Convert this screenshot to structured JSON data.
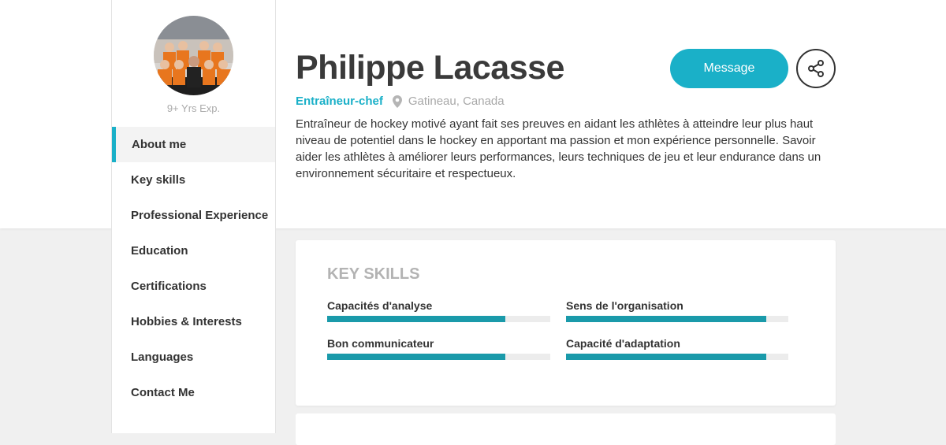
{
  "profile": {
    "name": "Philippe Lacasse",
    "role": "Entraîneur-chef",
    "location": "Gatineau, Canada",
    "experience": "9+ Yrs Exp.",
    "bio": "Entraîneur de hockey motivé ayant fait ses preuves en aidant les athlètes à atteindre leur plus haut niveau de potentiel dans le hockey en apportant ma passion et mon expérience personnelle. Savoir aider les athlètes à améliorer leurs performances, leurs techniques de jeu et leur endurance dans un environnement sécuritaire et respectueux."
  },
  "actions": {
    "message_label": "Message",
    "share_icon": "share-icon"
  },
  "nav": {
    "items": [
      {
        "label": "About me",
        "active": true
      },
      {
        "label": "Key skills"
      },
      {
        "label": "Professional Experience"
      },
      {
        "label": "Education"
      },
      {
        "label": "Certifications"
      },
      {
        "label": "Hobbies & Interests"
      },
      {
        "label": "Languages"
      },
      {
        "label": "Contact Me"
      }
    ]
  },
  "key_skills": {
    "title": "KEY SKILLS",
    "skills": [
      {
        "label": "Capacités d'analyse",
        "level": 0.8
      },
      {
        "label": "Sens de l'organisation",
        "level": 0.9
      },
      {
        "label": "Bon communicateur",
        "level": 0.8
      },
      {
        "label": "Capacité d'adaptation",
        "level": 0.9
      }
    ]
  },
  "colors": {
    "accent": "#1ab0c8",
    "bar_fill": "#1a9aaa",
    "bar_track": "#ececec"
  }
}
